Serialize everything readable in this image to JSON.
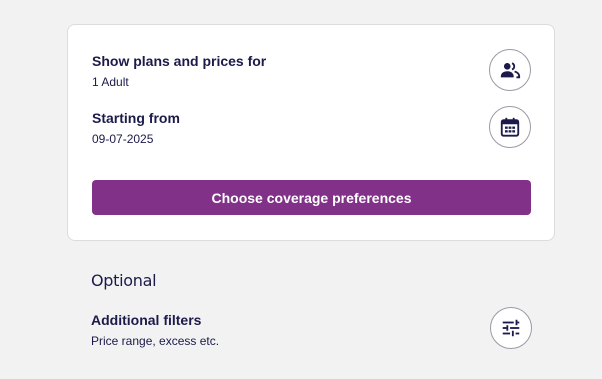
{
  "plans": {
    "title": "Show plans and prices for",
    "value": "1 Adult",
    "icon": "people-icon"
  },
  "start": {
    "title": "Starting from",
    "value": "09-07-2025",
    "icon": "calendar-icon"
  },
  "cta": {
    "label": "Choose coverage preferences"
  },
  "optional": {
    "heading": "Optional",
    "filters_title": "Additional filters",
    "filters_sub": "Price range, excess etc.",
    "icon": "sliders-icon"
  },
  "colors": {
    "primary": "#813188",
    "text": "#1b1a4a",
    "background": "#f2f2f2"
  }
}
